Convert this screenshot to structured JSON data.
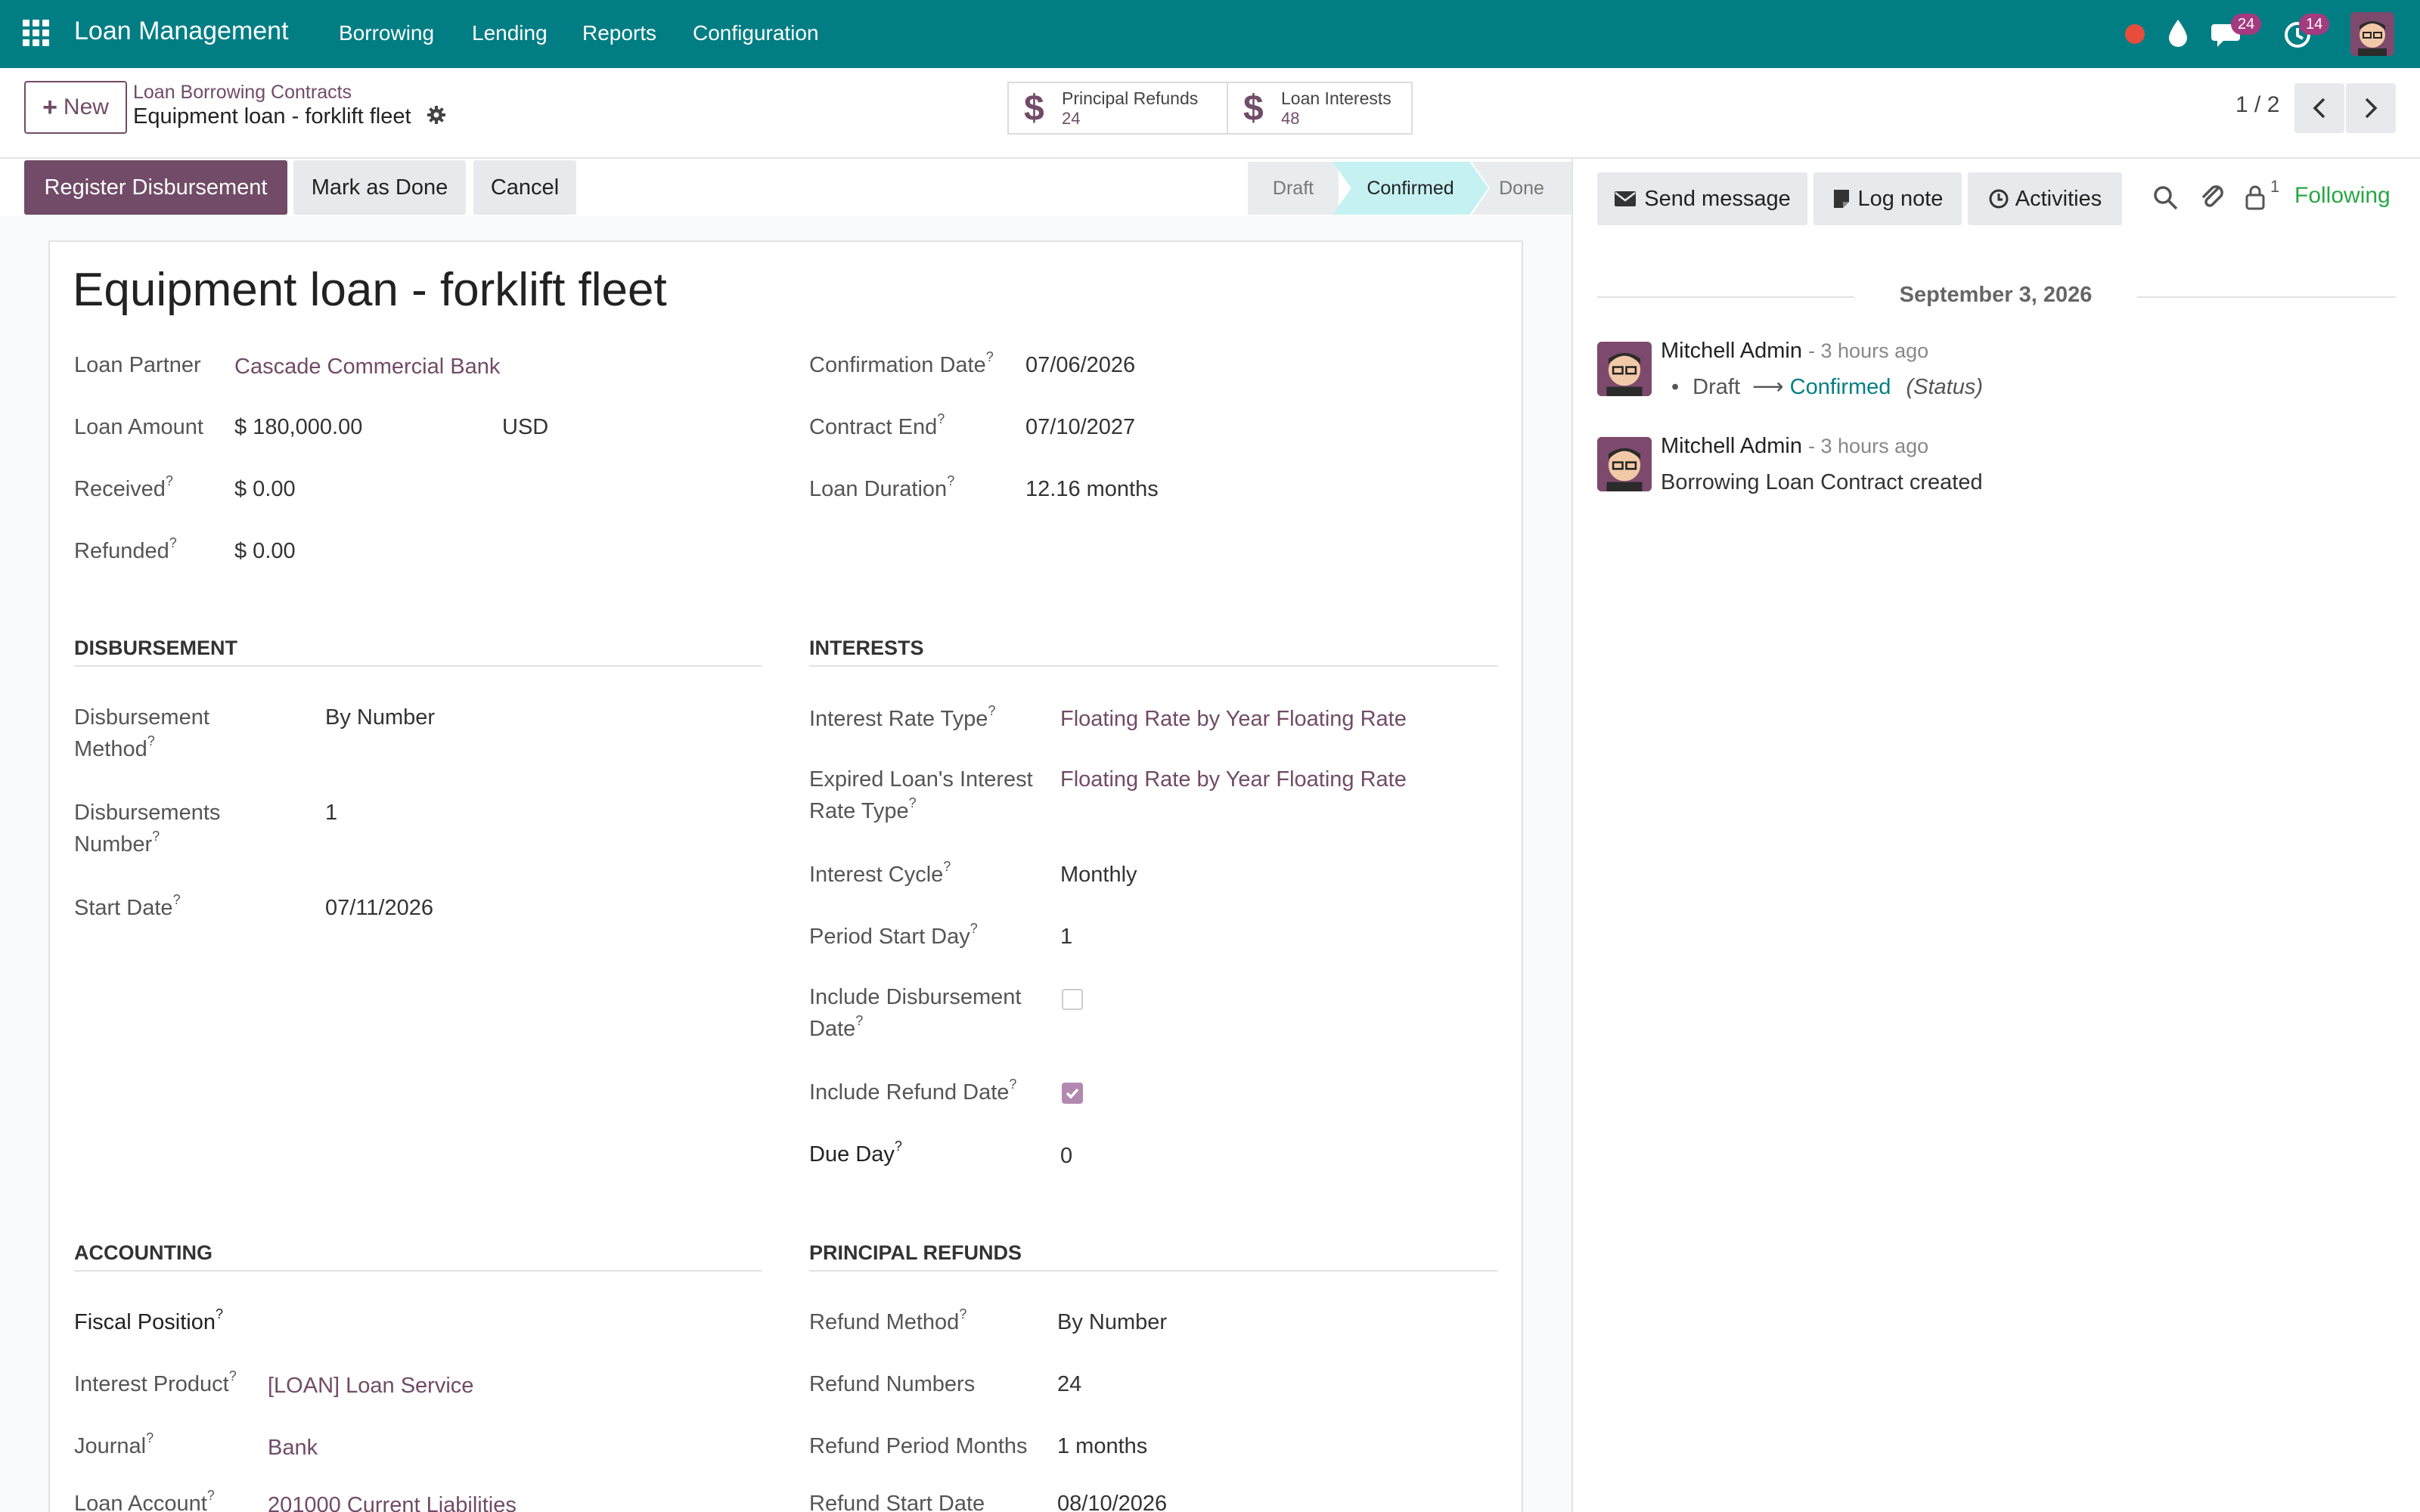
{
  "navbar": {
    "app_name": "Loan Management",
    "menus": [
      "Borrowing",
      "Lending",
      "Reports",
      "Configuration"
    ],
    "messages_badge": "24",
    "activities_badge": "14"
  },
  "control_panel": {
    "new_label": "New",
    "breadcrumb_parent": "Loan Borrowing Contracts",
    "breadcrumb_current": "Equipment loan - forklift fleet",
    "smart_buttons": [
      {
        "label": "Principal Refunds",
        "count": "24"
      },
      {
        "label": "Loan Interests",
        "count": "48"
      }
    ],
    "pager": "1 / 2"
  },
  "statusbar": {
    "actions": [
      "Register Disbursement",
      "Mark as Done",
      "Cancel"
    ],
    "stages": [
      "Draft",
      "Confirmed",
      "Done"
    ],
    "active_stage": "Confirmed"
  },
  "form": {
    "title": "Equipment loan - forklift fleet",
    "left_fields": [
      {
        "label": "Loan Partner",
        "value": "Cascade Commercial Bank"
      },
      {
        "label": "Loan Amount",
        "value": "$ 180,000.00",
        "currency": "USD"
      },
      {
        "label": "Received",
        "value": "$ 0.00"
      },
      {
        "label": "Refunded",
        "value": "$ 0.00"
      }
    ],
    "right_fields": [
      {
        "label": "Confirmation Date",
        "value": "07/06/2026"
      },
      {
        "label": "Contract End",
        "value": "07/10/2027"
      },
      {
        "label": "Loan Duration",
        "value": "12.16 months"
      }
    ],
    "disbursement": {
      "heading": "DISBURSEMENT",
      "method_label_1": "Disbursement",
      "method_label_2": "Method",
      "method_value": "By Number",
      "number_label_1": "Disbursements",
      "number_label_2": "Number",
      "number_value": "1",
      "start_label": "Start Date",
      "start_value": "07/11/2026"
    },
    "interests": {
      "heading": "INTERESTS",
      "rate_type_label": "Interest Rate Type",
      "rate_type_value": "Floating Rate by Year Floating Rate",
      "expired_label_1": "Expired Loan's Interest",
      "expired_label_2": "Rate Type",
      "expired_value": "Floating Rate by Year Floating Rate",
      "cycle_label": "Interest Cycle",
      "cycle_value": "Monthly",
      "period_label": "Period Start Day",
      "period_value": "1",
      "incl_disb_label_1": "Include Disbursement",
      "incl_disb_label_2": "Date",
      "incl_disb_checked": false,
      "incl_refund_label": "Include Refund Date",
      "incl_refund_checked": true,
      "due_label": "Due Day",
      "due_value": "0"
    },
    "accounting": {
      "heading": "ACCOUNTING",
      "fiscal_label": "Fiscal Position",
      "product_label": "Interest Product",
      "product_value": "[LOAN] Loan Service",
      "journal_label": "Journal",
      "journal_value": "Bank",
      "account_label": "Loan Account",
      "account_value": "201000 Current Liabilities"
    },
    "principal_refunds": {
      "heading": "PRINCIPAL REFUNDS",
      "method_label": "Refund Method",
      "method_value": "By Number",
      "numbers_label": "Refund Numbers",
      "numbers_value": "24",
      "months_label": "Refund Period Months",
      "months_value": "1 months",
      "start_label": "Refund Start Date",
      "start_value": "08/10/2026"
    }
  },
  "chatter": {
    "send_message": "Send message",
    "log_note": "Log note",
    "activities": "Activities",
    "followers_count": "1",
    "following": "Following",
    "date_separator": "September 3, 2026",
    "messages": [
      {
        "author": "Mitchell Admin",
        "time": "- 3 hours ago",
        "old_value": "Draft",
        "new_value": "Confirmed",
        "field": "(Status)"
      },
      {
        "author": "Mitchell Admin",
        "time": "- 3 hours ago",
        "body": "Borrowing Loan Contract created"
      }
    ]
  },
  "colors": {
    "navbar": "#017e84",
    "primary": "#714b67",
    "link": "#714b67",
    "badge": "#a43b7f"
  }
}
